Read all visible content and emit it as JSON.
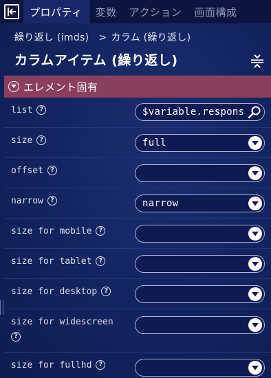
{
  "tabs": [
    {
      "label": "プロパティ",
      "active": true
    },
    {
      "label": "変数",
      "active": false
    },
    {
      "label": "アクション",
      "active": false
    },
    {
      "label": "画面構成",
      "active": false
    }
  ],
  "breadcrumb": {
    "parent": "繰り返し (imds)",
    "separator": ">",
    "current": "カラム (繰り返し)"
  },
  "page_title": "カラムアイテム (繰り返し)",
  "section": {
    "label": "エレメント固有"
  },
  "properties": [
    {
      "label": "list",
      "value": "$variable.respons",
      "control": "search"
    },
    {
      "label": "size",
      "value": "full",
      "control": "dropdown"
    },
    {
      "label": "offset",
      "value": "",
      "control": "dropdown"
    },
    {
      "label": "narrow",
      "value": "narrow",
      "control": "dropdown"
    },
    {
      "label": "size for mobile",
      "value": "",
      "control": "dropdown"
    },
    {
      "label": "size for tablet",
      "value": "",
      "control": "dropdown"
    },
    {
      "label": "size for desktop",
      "value": "",
      "control": "dropdown"
    },
    {
      "label": "size for widescreen",
      "value": "",
      "control": "dropdown"
    },
    {
      "label": "size for fullhd",
      "value": "",
      "control": "dropdown"
    }
  ],
  "help_glyph": "?",
  "colors": {
    "section_header": "#8a3f5f",
    "background": "#132561",
    "tabbar": "#0a1540"
  }
}
